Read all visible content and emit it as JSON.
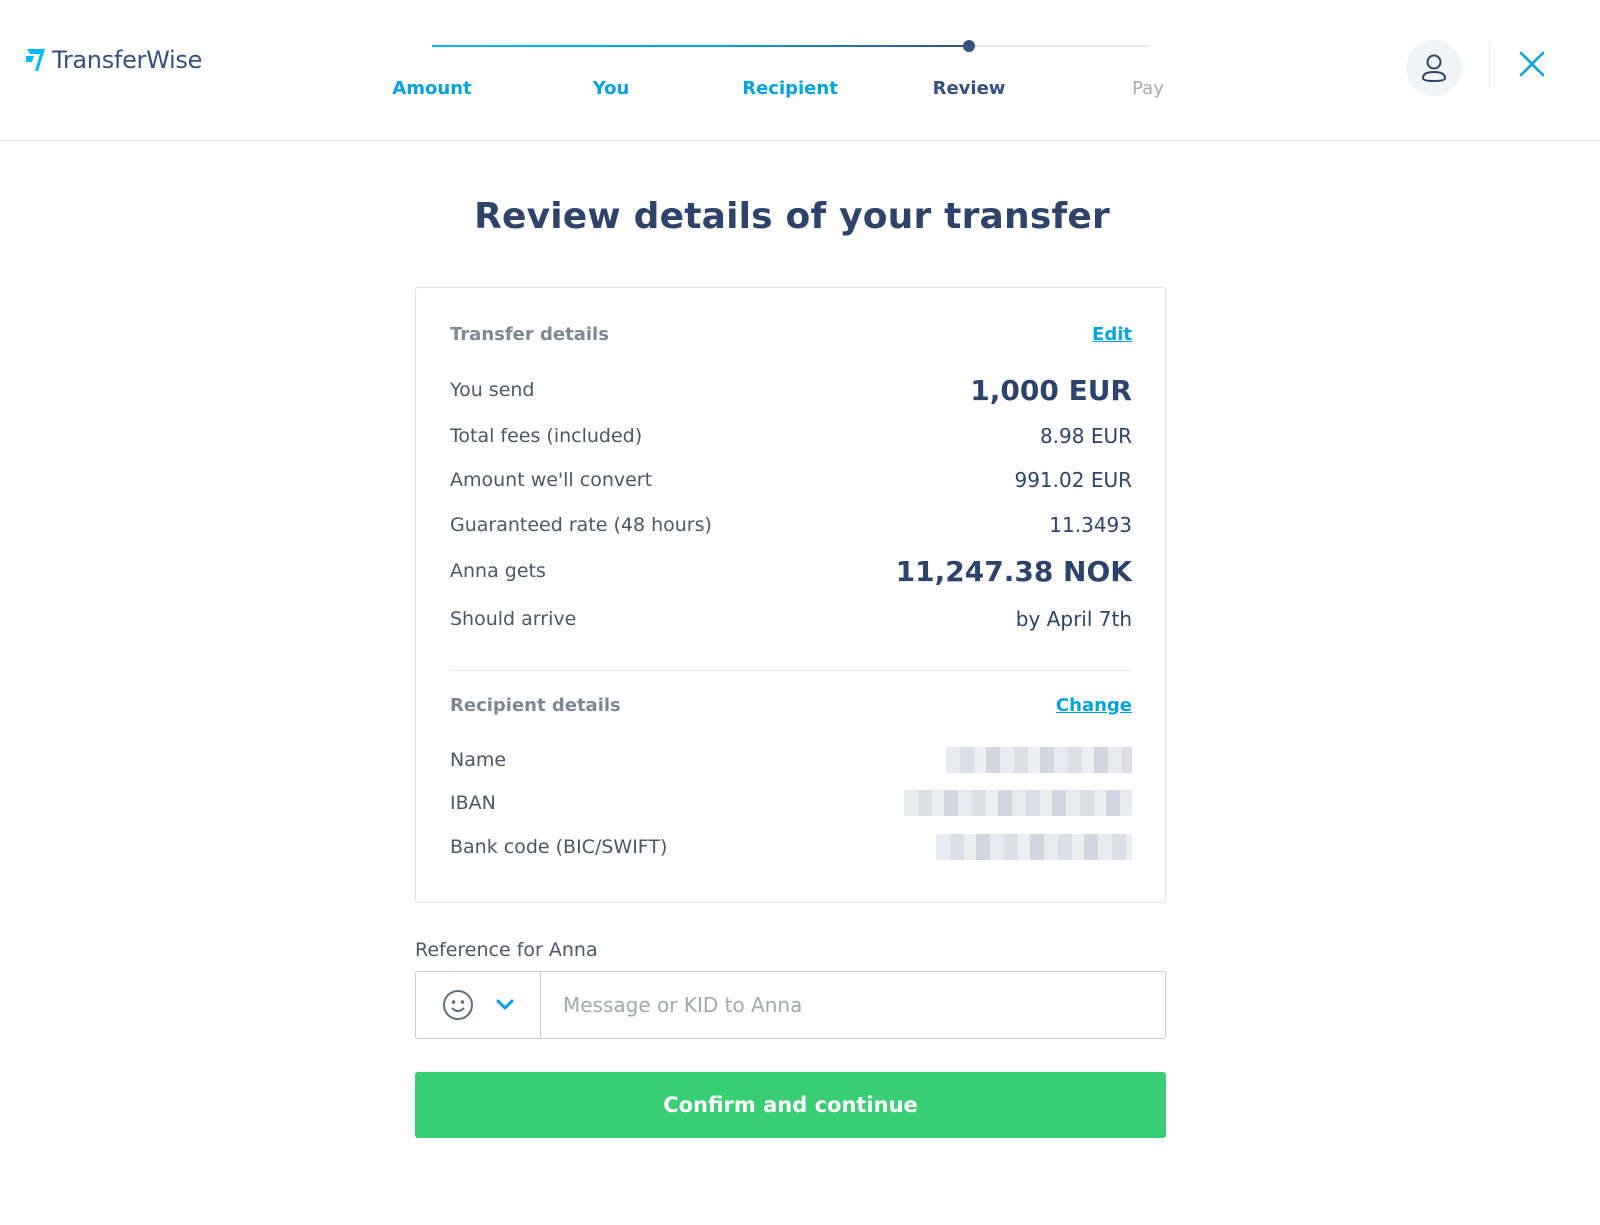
{
  "brand": {
    "name": "TransferWise",
    "logo_icon": "transferwise-flag-icon",
    "accent_color": "#00a2dd",
    "navy_color": "#37517e",
    "cta_color": "#3ace74"
  },
  "stepper": {
    "progress": 0.75,
    "steps": [
      {
        "label": "Amount",
        "state": "done"
      },
      {
        "label": "You",
        "state": "done"
      },
      {
        "label": "Recipient",
        "state": "done"
      },
      {
        "label": "Review",
        "state": "active"
      },
      {
        "label": "Pay",
        "state": "todo"
      }
    ]
  },
  "header_actions": {
    "profile_icon": "user-icon",
    "close_icon": "close-icon"
  },
  "page": {
    "title": "Review details of your transfer"
  },
  "transfer_details": {
    "section_label": "Transfer details",
    "edit_label": "Edit",
    "rows": [
      {
        "label": "You send",
        "value": "1,000 EUR"
      },
      {
        "label": "Total fees (included)",
        "value": "8.98 EUR"
      },
      {
        "label": "Amount we'll convert",
        "value": "991.02 EUR"
      },
      {
        "label": "Guaranteed rate (48 hours)",
        "value": "11.3493"
      },
      {
        "label": "Anna gets",
        "value": "11,247.38 NOK"
      },
      {
        "label": "Should arrive",
        "value": "by April 7th"
      }
    ]
  },
  "recipient_details": {
    "section_label": "Recipient details",
    "change_label": "Change",
    "rows": [
      {
        "label": "Name"
      },
      {
        "label": "IBAN"
      },
      {
        "label": "Bank code (BIC/SWIFT)"
      }
    ]
  },
  "reference": {
    "label": "Reference for Anna",
    "placeholder": "Message or KID to Anna",
    "value": "",
    "emoji_icon": "smiley-icon",
    "dropdown_icon": "chevron-down-icon"
  },
  "confirm_button": {
    "label": "Confirm and continue"
  }
}
